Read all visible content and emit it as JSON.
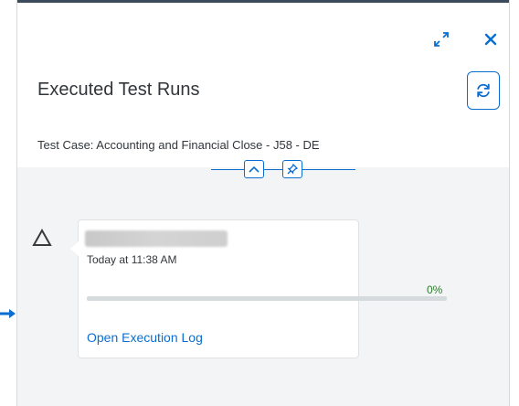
{
  "dialog": {
    "title": "Executed Test Runs",
    "subtitle": "Test Case: Accounting and Financial Close - J58 - DE",
    "fullscreen_icon": "fullscreen-icon",
    "close_icon": "close-icon",
    "refresh_icon": "refresh-icon"
  },
  "header_toggle": {
    "collapse_icon": "chevron-up-icon",
    "pin_icon": "pin-icon"
  },
  "run": {
    "status_icon": "warning-triangle-icon",
    "name": "",
    "timestamp": "Today at 11:38 AM",
    "progress_label": "0%",
    "progress": 0,
    "link_label": "Open Execution Log"
  },
  "colors": {
    "accent": "#0a6ed1",
    "progress": "#2b7d2b",
    "body_bg": "#f3f4f5"
  }
}
